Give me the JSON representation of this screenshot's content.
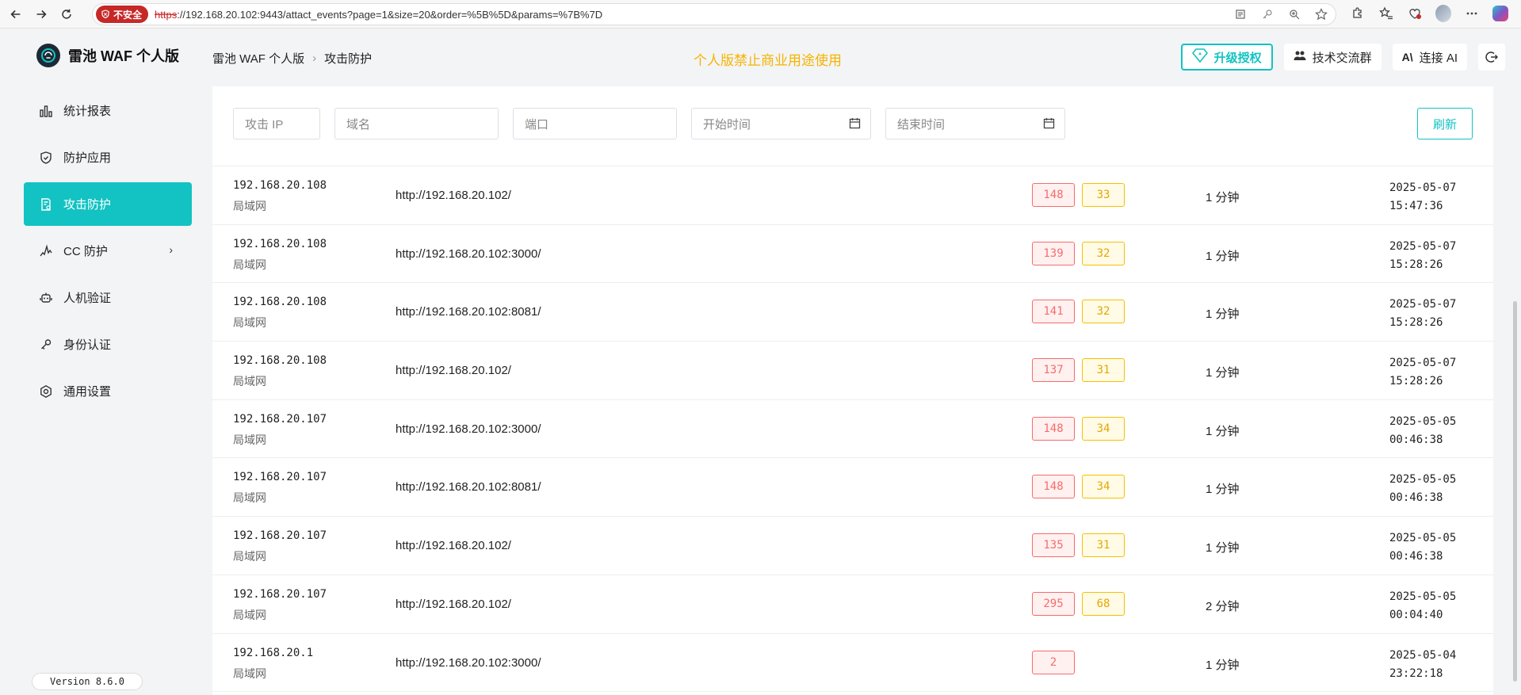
{
  "browser": {
    "security_label": "不安全",
    "url_scheme": "https",
    "url_rest": "://192.168.20.102:9443/attact_events?page=1&size=20&order=%5B%5D&params=%7B%7D"
  },
  "app": {
    "brand": "雷池 WAF 个人版",
    "version": "Version 8.6.0"
  },
  "sidebar": {
    "items": [
      {
        "label": "统计报表",
        "icon": "bar-chart-icon"
      },
      {
        "label": "防护应用",
        "icon": "shield-icon"
      },
      {
        "label": "攻击防护",
        "icon": "document-shield-icon",
        "active": true
      },
      {
        "label": "CC 防护",
        "icon": "wave-icon",
        "has_submenu": true
      },
      {
        "label": "人机验证",
        "icon": "robot-icon"
      },
      {
        "label": "身份认证",
        "icon": "key-icon"
      },
      {
        "label": "通用设置",
        "icon": "gear-icon"
      }
    ]
  },
  "header": {
    "breadcrumb": [
      "雷池 WAF 个人版",
      "攻击防护"
    ],
    "notice": "个人版禁止商业用途使用",
    "upgrade_label": "升级授权",
    "group_label": "技术交流群",
    "ai_label": "连接 AI"
  },
  "filters": {
    "attack_ip": "攻击 IP",
    "domain": "域名",
    "port": "端口",
    "start_time": "开始时间",
    "end_time": "结束时间",
    "refresh": "刷新"
  },
  "events": [
    {
      "ip": "192.168.20.108",
      "region": "局域网",
      "url": "http://192.168.20.102/",
      "count_red": "148",
      "count_yellow": "33",
      "duration": "1 分钟",
      "date": "2025-05-07",
      "time": "15:47:36"
    },
    {
      "ip": "192.168.20.108",
      "region": "局域网",
      "url": "http://192.168.20.102:3000/",
      "count_red": "139",
      "count_yellow": "32",
      "duration": "1 分钟",
      "date": "2025-05-07",
      "time": "15:28:26"
    },
    {
      "ip": "192.168.20.108",
      "region": "局域网",
      "url": "http://192.168.20.102:8081/",
      "count_red": "141",
      "count_yellow": "32",
      "duration": "1 分钟",
      "date": "2025-05-07",
      "time": "15:28:26"
    },
    {
      "ip": "192.168.20.108",
      "region": "局域网",
      "url": "http://192.168.20.102/",
      "count_red": "137",
      "count_yellow": "31",
      "duration": "1 分钟",
      "date": "2025-05-07",
      "time": "15:28:26"
    },
    {
      "ip": "192.168.20.107",
      "region": "局域网",
      "url": "http://192.168.20.102:3000/",
      "count_red": "148",
      "count_yellow": "34",
      "duration": "1 分钟",
      "date": "2025-05-05",
      "time": "00:46:38"
    },
    {
      "ip": "192.168.20.107",
      "region": "局域网",
      "url": "http://192.168.20.102:8081/",
      "count_red": "148",
      "count_yellow": "34",
      "duration": "1 分钟",
      "date": "2025-05-05",
      "time": "00:46:38"
    },
    {
      "ip": "192.168.20.107",
      "region": "局域网",
      "url": "http://192.168.20.102/",
      "count_red": "135",
      "count_yellow": "31",
      "duration": "1 分钟",
      "date": "2025-05-05",
      "time": "00:46:38"
    },
    {
      "ip": "192.168.20.107",
      "region": "局域网",
      "url": "http://192.168.20.102/",
      "count_red": "295",
      "count_yellow": "68",
      "duration": "2 分钟",
      "date": "2025-05-05",
      "time": "00:04:40"
    },
    {
      "ip": "192.168.20.1",
      "region": "局域网",
      "url": "http://192.168.20.102:3000/",
      "count_red": "2",
      "count_yellow": null,
      "duration": "1 分钟",
      "date": "2025-05-04",
      "time": "23:22:18"
    }
  ],
  "colors": {
    "accent": "#13c2c2",
    "warning_text": "#f5b400",
    "badge_red": "#f56c6c",
    "badge_yellow": "#f5c000"
  }
}
